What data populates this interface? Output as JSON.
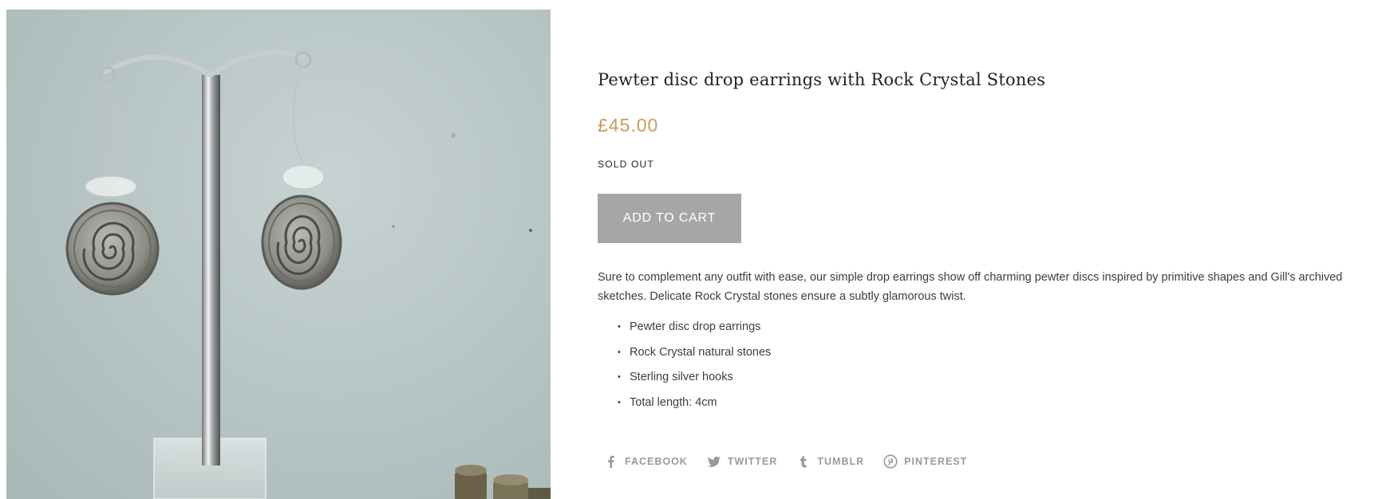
{
  "product": {
    "image_alt": "Pewter disc drop earrings hanging on a silver display stand",
    "title": "Pewter disc drop earrings with Rock Crystal Stones",
    "price": "£45.00",
    "availability": "SOLD OUT",
    "add_to_cart_label": "ADD TO CART",
    "description": "Sure to complement any outfit with ease, our simple drop earrings show off charming pewter discs inspired by primitive shapes and Gill's archived sketches. Delicate Rock Crystal stones ensure a subtly glamorous twist.",
    "features": [
      "Pewter disc drop earrings",
      "Rock Crystal natural stones",
      "Sterling silver hooks",
      "Total length: 4cm"
    ]
  },
  "share": [
    {
      "label": "FACEBOOK",
      "icon": "facebook-icon"
    },
    {
      "label": "TWITTER",
      "icon": "twitter-icon"
    },
    {
      "label": "TUMBLR",
      "icon": "tumblr-icon"
    },
    {
      "label": "PINTEREST",
      "icon": "pinterest-icon"
    }
  ],
  "colors": {
    "price": "#c99a5b",
    "button_bg": "#a6a6a6",
    "share_text": "#9a9a9a"
  }
}
